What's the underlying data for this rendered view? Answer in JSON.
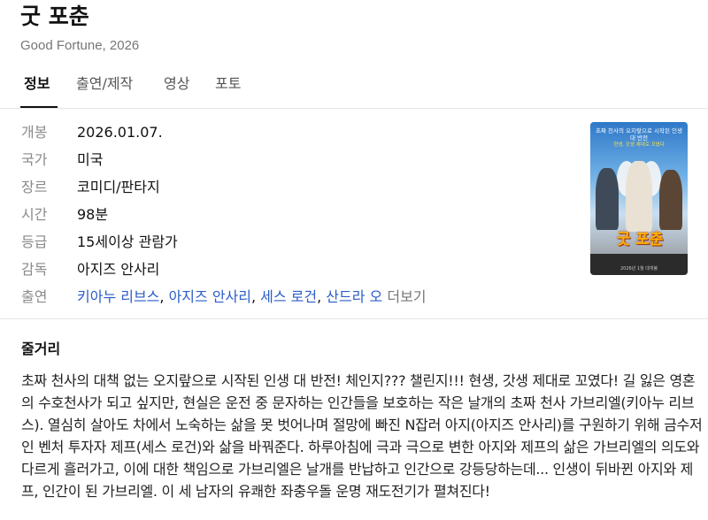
{
  "header": {
    "title": "굿 포춘",
    "subtitle": "Good Fortune, 2026"
  },
  "tabs": [
    {
      "label": "정보",
      "active": true
    },
    {
      "label": "출연/제작",
      "active": false
    },
    {
      "label": "영상",
      "active": false
    },
    {
      "label": "포토",
      "active": false
    }
  ],
  "info": {
    "release": {
      "label": "개봉",
      "value": "2026.01.07."
    },
    "country": {
      "label": "국가",
      "value": "미국"
    },
    "genre": {
      "label": "장르",
      "value": "코미디/판타지"
    },
    "runtime": {
      "label": "시간",
      "value": "98분"
    },
    "rating": {
      "label": "등급",
      "value": "15세이상 관람가"
    },
    "director": {
      "label": "감독",
      "value": "아지즈 안사리"
    },
    "cast": {
      "label": "출연",
      "names": [
        "키아누 리브스",
        "아지즈 안사리",
        "세스 로건",
        "산드라 오"
      ],
      "separator": ", ",
      "more": "더보기"
    }
  },
  "poster": {
    "top_text": "초짜 천사의 오지랖으로 시작된 인생 대 반전",
    "tagline": "현생, 갓생 제대로 꼬였다",
    "title": "굿 포춘",
    "bottom_text": "2026년 1월 대개봉"
  },
  "synopsis": {
    "heading": "줄거리",
    "text": "초짜 천사의 대책 없는 오지랖으로 시작된 인생 대 반전! 체인지??? 챌린지!!! 현생, 갓생 제대로 꼬였다! 길 잃은 영혼의 수호천사가 되고 싶지만, 현실은 운전 중 문자하는 인간들을 보호하는 작은 날개의 초짜 천사 가브리엘(키아누 리브스). 열심히 살아도 차에서 노숙하는 삶을 못 벗어나며 절망에 빠진 N잡러 아지(아지즈 안사리)를 구원하기 위해 금수저인 벤처 투자자 제프(세스 로건)와 삶을 바꿔준다. 하루아침에 극과 극으로 변한 아지와 제프의 삶은 가브리엘의 의도와 다르게 흘러가고, 이에 대한 책임으로 가브리엘은 날개를 반납하고 인간으로 강등당하는데... 인생이 뒤바뀐 아지와 제프, 인간이 된 가브리엘. 이 세 남자의 유쾌한 좌충우돌 운명 재도전기가 펼쳐진다!"
  },
  "colors": {
    "link": "#2a5cc9",
    "label": "#8a8a8a",
    "muted": "#767676"
  }
}
